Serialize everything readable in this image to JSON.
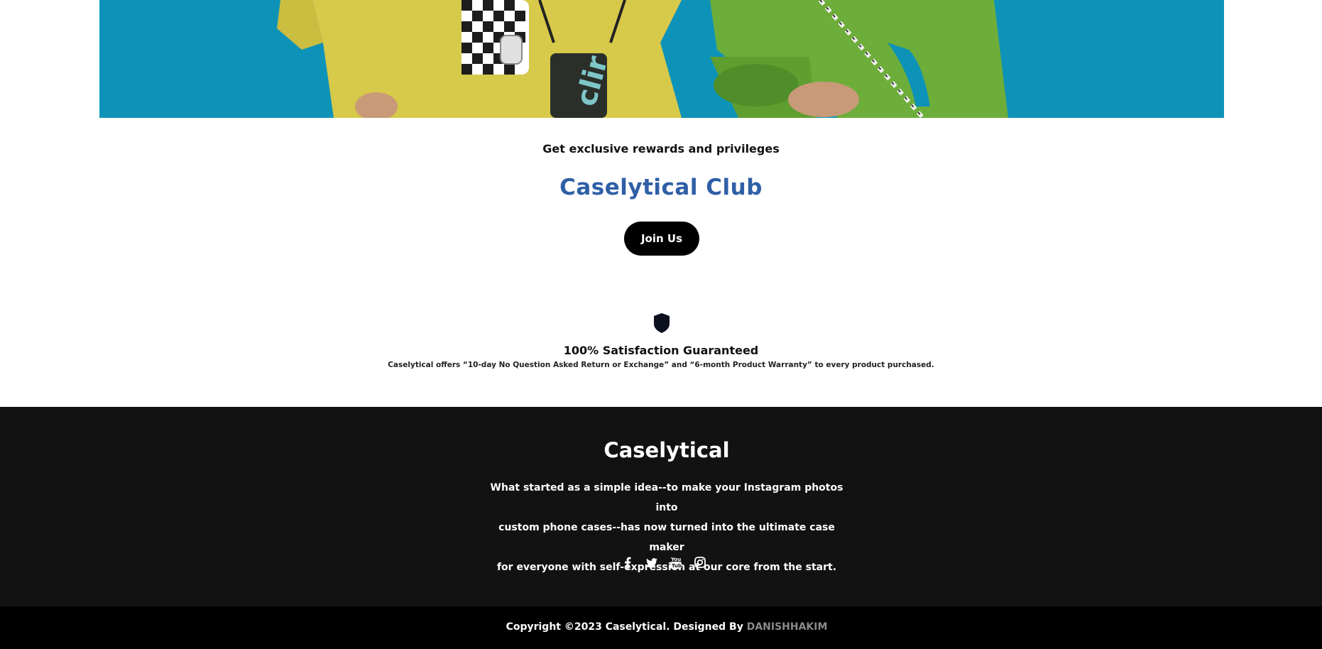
{
  "hero": {
    "background_color": "#0e93b8"
  },
  "club": {
    "tagline": "Get exclusive rewards and privileges",
    "title": "Caselytical Club",
    "join_label": "Join Us",
    "title_color": "#2f5fa6"
  },
  "guarantee": {
    "icon": "shield-icon",
    "title": "100% Satisfaction Guaranteed",
    "description": "Caselytical offers “10-day No Question Asked Return or Exchange” and “6-month Product Warranty” to every product purchased."
  },
  "footer": {
    "brand": "Caselytical",
    "about_lines": [
      "What started as a simple idea--to make your Instagram photos into",
      "custom phone cases--has now turned into the ultimate case maker",
      "for everyone with self-expression at our core from the start."
    ],
    "social_icons": [
      "facebook-icon",
      "twitter-icon",
      "youtube-icon",
      "instagram-icon"
    ],
    "background_color": "#121212"
  },
  "copyright": {
    "text": "Copyright ©2023 Caselytical. Designed By ",
    "designer": "DANISHHAKIM",
    "designer_color": "#8a8a8a"
  }
}
